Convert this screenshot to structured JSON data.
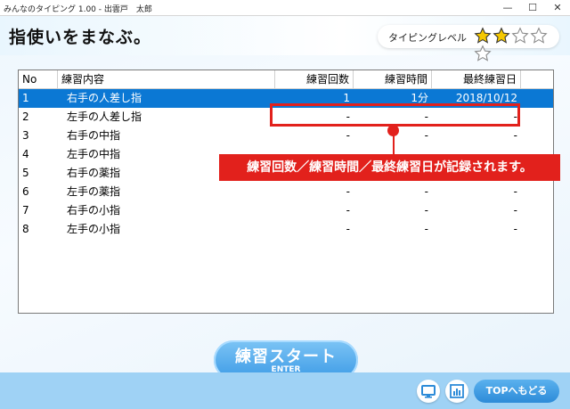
{
  "window": {
    "title": "みんなのタイピング 1.00 - 出雲戸　太郎",
    "minimize": "—",
    "maximize": "☐",
    "close": "✕"
  },
  "header": {
    "title": "指使いをまなぶ。",
    "level_label": "タイピングレベル",
    "stars_filled": 2,
    "stars_total": 5
  },
  "colors": {
    "accent": "#0b78d4",
    "callout": "#e2211c",
    "star_fill": "#f5c800"
  },
  "table": {
    "columns": [
      "No",
      "練習内容",
      "練習回数",
      "練習時間",
      "最終練習日"
    ],
    "rows": [
      {
        "no": "1",
        "name": "右手の人差し指",
        "count": "1",
        "time": "1分",
        "date": "2018/10/12",
        "selected": true
      },
      {
        "no": "2",
        "name": "左手の人差し指",
        "count": "-",
        "time": "-",
        "date": "-"
      },
      {
        "no": "3",
        "name": "右手の中指",
        "count": "-",
        "time": "-",
        "date": "-"
      },
      {
        "no": "4",
        "name": "左手の中指",
        "count": "-",
        "time": "-",
        "date": "-"
      },
      {
        "no": "5",
        "name": "右手の薬指",
        "count": "-",
        "time": "-",
        "date": "-"
      },
      {
        "no": "6",
        "name": "左手の薬指",
        "count": "-",
        "time": "-",
        "date": "-"
      },
      {
        "no": "7",
        "name": "右手の小指",
        "count": "-",
        "time": "-",
        "date": "-"
      },
      {
        "no": "8",
        "name": "左手の小指",
        "count": "-",
        "time": "-",
        "date": "-"
      }
    ]
  },
  "callout": "練習回数／練習時間／最終練習日が記録されます。",
  "start_button": {
    "label": "練習スタート",
    "sub": "ENTER"
  },
  "footer": {
    "top_label": "TOPへもどる",
    "icons": [
      "monitor-icon",
      "chart-icon"
    ]
  }
}
